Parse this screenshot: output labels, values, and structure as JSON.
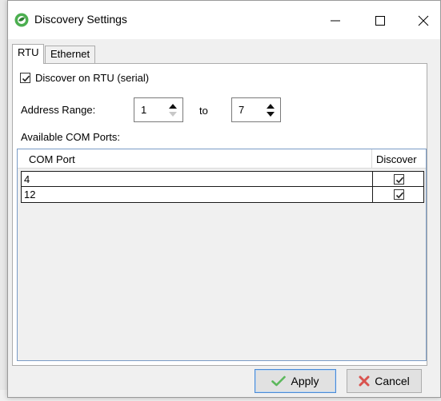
{
  "window": {
    "title": "Discovery Settings"
  },
  "tabs": [
    {
      "label": "RTU",
      "active": true
    },
    {
      "label": "Ethernet",
      "active": false
    }
  ],
  "rtu": {
    "discover_label": "Discover on RTU (serial)",
    "discover_checked": true,
    "address_range_label": "Address Range:",
    "range_from": "1",
    "range_to": "7",
    "to_label": "to",
    "ports_label": "Available COM Ports:"
  },
  "table": {
    "columns": [
      "COM Port",
      "Discover"
    ],
    "rows": [
      {
        "port": "4",
        "discover": true
      },
      {
        "port": "12",
        "discover": true
      }
    ]
  },
  "buttons": {
    "apply_label": "Apply",
    "cancel_label": "Cancel"
  },
  "colors": {
    "accent": "#4a8ad4",
    "app_icon": "#4caf50",
    "apply_check": "#5cb85c",
    "cancel_x": "#d9534f"
  }
}
